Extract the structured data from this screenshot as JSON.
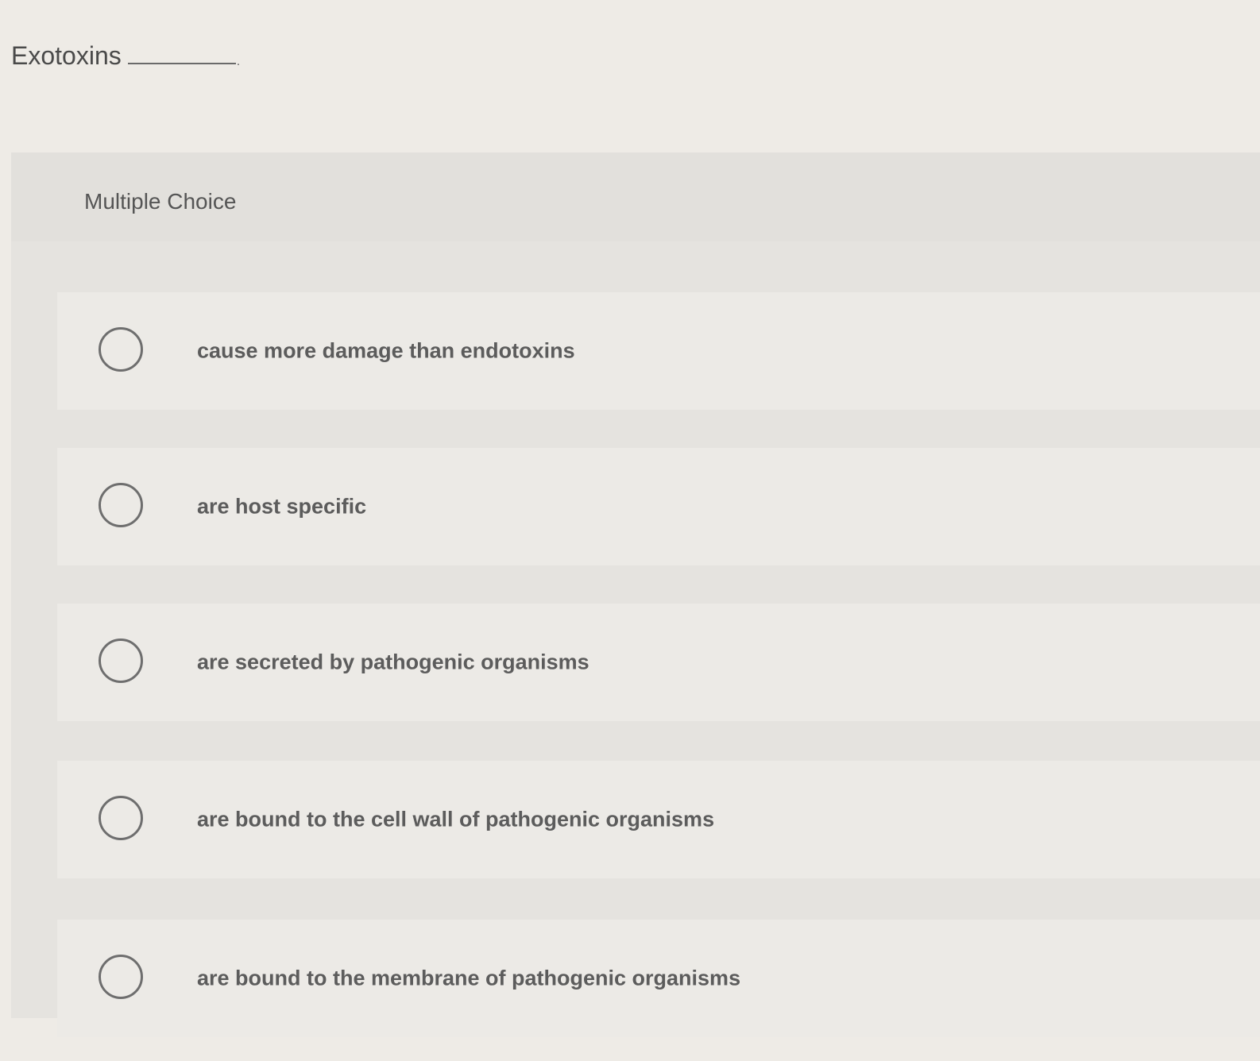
{
  "question": {
    "stem": "Exotoxins",
    "terminator": "."
  },
  "panel": {
    "title": "Multiple Choice"
  },
  "options": [
    {
      "label": "cause more damage than endotoxins"
    },
    {
      "label": "are host specific"
    },
    {
      "label": "are secreted by pathogenic organisms"
    },
    {
      "label": "are bound to the cell wall of pathogenic organisms"
    },
    {
      "label": "are bound to the membrane of pathogenic organisms"
    }
  ],
  "icons": {
    "radio": "radio-unselected-icon"
  }
}
